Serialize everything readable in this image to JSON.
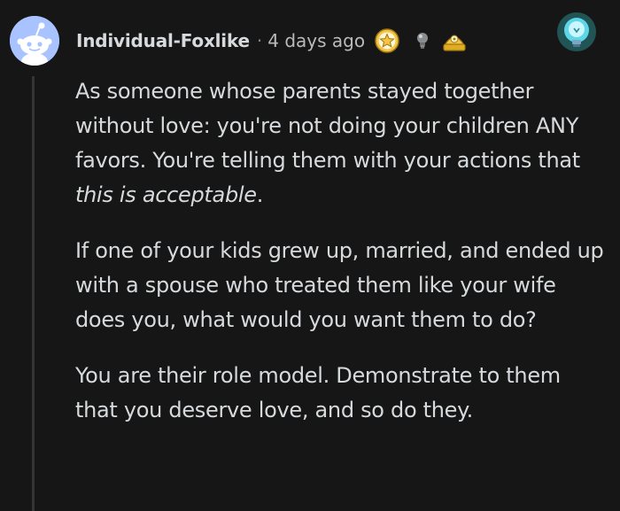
{
  "comment": {
    "author": "Individual-Foxlike",
    "separator": "·",
    "time_ago": "4 days ago",
    "awards": [
      "star-award-icon",
      "lightbulb-award-icon",
      "helpful-award-icon"
    ],
    "corner_award": "lightbulb-glow-icon",
    "paragraphs": {
      "p1": {
        "before": "As someone whose parents stayed together without love: you're not doing your children ANY favors. You're telling them with your actions that ",
        "emphasis": "this is acceptable",
        "after": "."
      },
      "p2": "If one of your kids grew up, married, and ended up with a spouse who treated them like your wife does you, what would you want them to do?",
      "p3": "You are their role model. Demonstrate to them that you deserve love, and so do they."
    }
  },
  "colors": {
    "background": "#161616",
    "text": "#d7dadc",
    "muted": "#818384",
    "avatar_bg": "#a8c3ff",
    "thread_line": "#343536"
  }
}
